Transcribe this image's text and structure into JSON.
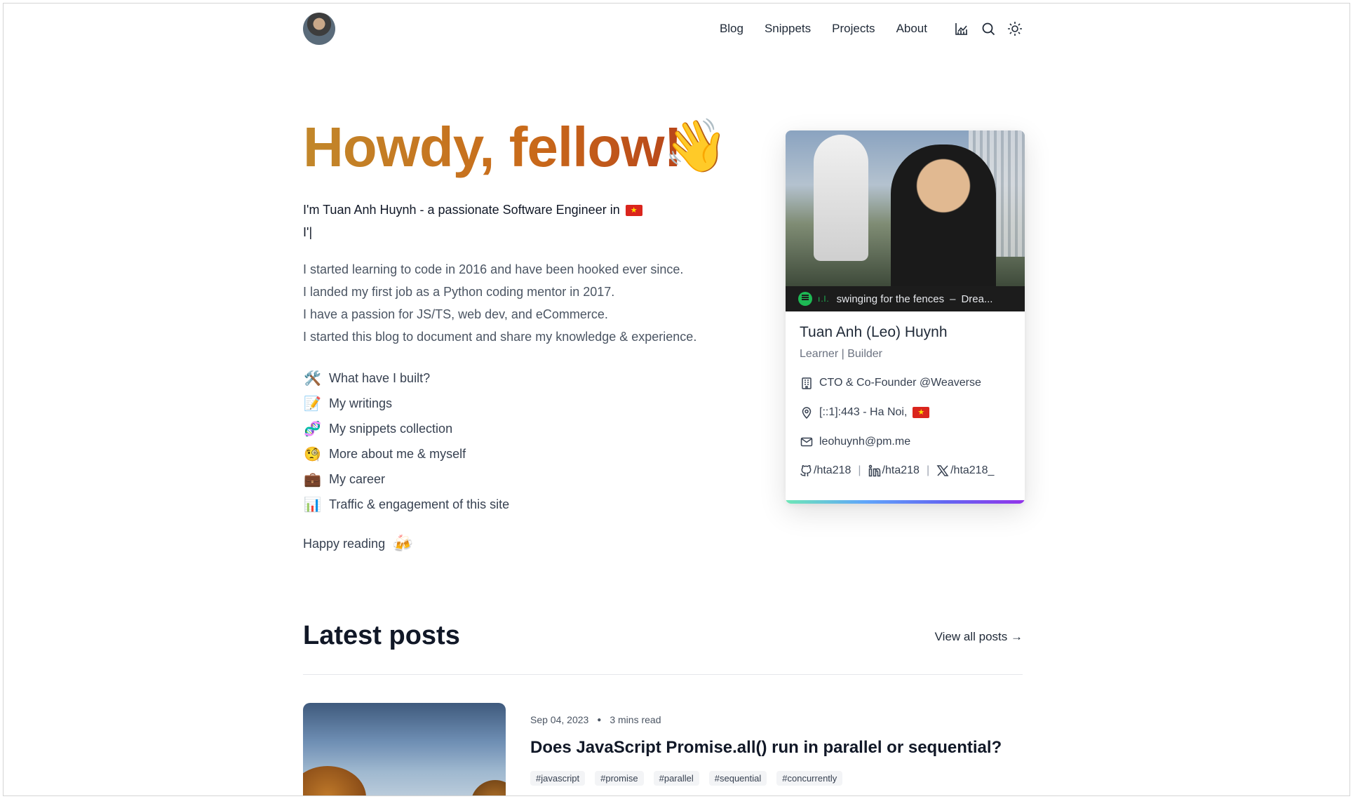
{
  "nav": {
    "links": [
      "Blog",
      "Snippets",
      "Projects",
      "About"
    ]
  },
  "hero": {
    "title": "Howdy, fellow!",
    "wave_emoji": "👋",
    "intro_line": "I'm Tuan Anh Huynh - a passionate Software Engineer in",
    "typing_line": "I'|",
    "bio": [
      "I started learning to code in 2016 and have been hooked ever since.",
      "I landed my first job as a Python coding mentor in 2017.",
      "I have a passion for JS/TS, web dev, and eCommerce.",
      "I started this blog to document and share my knowledge & experience."
    ],
    "links": [
      {
        "emoji": "🛠️",
        "label": "What have I built?"
      },
      {
        "emoji": "📝",
        "label": "My writings"
      },
      {
        "emoji": "🧬",
        "label": "My snippets collection"
      },
      {
        "emoji": "🧐",
        "label": "More about me & myself"
      },
      {
        "emoji": "💼",
        "label": "My career"
      },
      {
        "emoji": "📊",
        "label": "Traffic & engagement of this site"
      }
    ],
    "happy": "Happy reading",
    "happy_emoji": "🍻"
  },
  "card": {
    "now_playing": "swinging for the fences",
    "now_playing_artist": "Drea...",
    "name": "Tuan Anh (Leo) Huynh",
    "role": "Learner | Builder",
    "job": "CTO & Co-Founder @Weaverse",
    "location": "[::1]:443 - Ha Noi,",
    "email": "leohuynh@pm.me",
    "github": "/hta218",
    "linkedin": "/hta218",
    "x": "/hta218_"
  },
  "latest": {
    "title": "Latest posts",
    "view_all": "View all posts →",
    "post": {
      "date": "Sep 04, 2023",
      "read_time": "3 mins read",
      "title": "Does JavaScript Promise.all() run in parallel or sequential?",
      "tags": [
        "#javascript",
        "#promise",
        "#parallel",
        "#sequential",
        "#concurrently"
      ]
    }
  },
  "colors": {
    "title_gradient_start": "#c2872a",
    "title_gradient_end": "#b8461a",
    "spotify_green": "#1db954"
  }
}
